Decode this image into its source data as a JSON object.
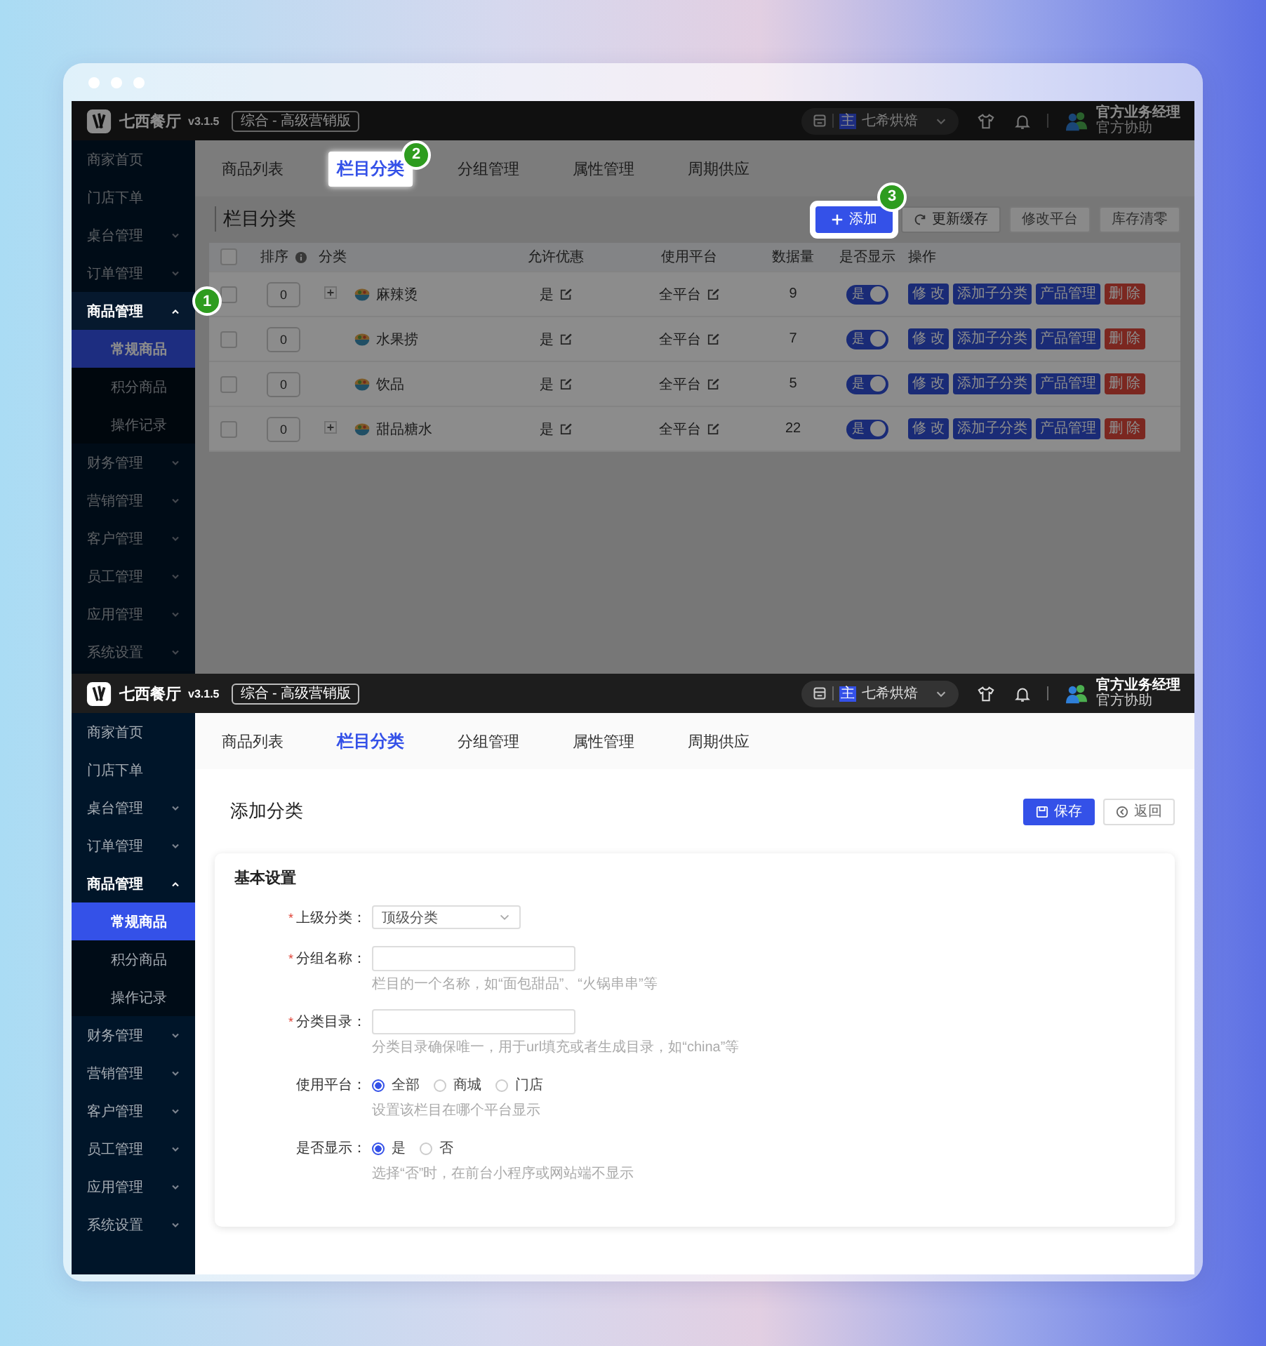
{
  "screens": [
    {
      "kind": "table",
      "dimmed": true,
      "header": {
        "brand": "七西餐厅",
        "version": "v3.1.5",
        "edition": "综合 - 高级营销版",
        "store_badge": "主",
        "store": "七希烘焙",
        "user_name": "官方业务经理",
        "user_role": "官方协助"
      },
      "sidebar": [
        {
          "label": "商家首页",
          "selected": false
        },
        {
          "label": "门店下单",
          "selected": false
        },
        {
          "label": "桌台管理",
          "selected": false,
          "expanded": false
        },
        {
          "label": "订单管理",
          "selected": false,
          "expanded": false
        },
        {
          "label": "商品管理",
          "selected": false,
          "expanded": true,
          "highlighted": true,
          "callout": "1",
          "children": [
            {
              "label": "常规商品",
              "selected": true
            },
            {
              "label": "积分商品",
              "selected": false
            },
            {
              "label": "操作记录",
              "selected": false
            }
          ]
        },
        {
          "label": "财务管理",
          "selected": false,
          "expanded": false
        },
        {
          "label": "营销管理",
          "selected": false,
          "expanded": false
        },
        {
          "label": "客户管理",
          "selected": false,
          "expanded": false
        },
        {
          "label": "员工管理",
          "selected": false,
          "expanded": false
        },
        {
          "label": "应用管理",
          "selected": false,
          "expanded": false
        },
        {
          "label": "系统设置",
          "selected": false,
          "expanded": false
        }
      ],
      "tabs": [
        {
          "label": "商品列表",
          "selected": false
        },
        {
          "label": "栏目分类",
          "selected": true,
          "highlighted": true,
          "callout": "2"
        },
        {
          "label": "分组管理",
          "selected": false
        },
        {
          "label": "属性管理",
          "selected": false
        },
        {
          "label": "周期供应",
          "selected": false
        }
      ],
      "title": "栏目分类",
      "toolbar": [
        {
          "label": "添加",
          "kind": "add",
          "disabled": false,
          "highlighted": true,
          "callout": "3"
        },
        {
          "label": "更新缓存",
          "kind": "refresh",
          "disabled": false
        },
        {
          "label": "修改平台",
          "kind": "plain",
          "disabled": true
        },
        {
          "label": "库存清零",
          "kind": "plain",
          "disabled": true
        }
      ],
      "table": {
        "select_all_checked": false,
        "columns": [
          {
            "label": "排序",
            "info": true
          },
          {
            "label": "分类"
          },
          {
            "label": "允许优惠"
          },
          {
            "label": "使用平台"
          },
          {
            "label": "数据量"
          },
          {
            "label": "是否显示"
          },
          {
            "label": "操作"
          }
        ],
        "rows": [
          {
            "checked": false,
            "sort": "0",
            "has_children": true,
            "name": "麻辣烫",
            "discount": "是",
            "platform": "全平台",
            "count": "9",
            "show": {
              "on": true,
              "label": "是"
            },
            "actions": [
              {
                "label": "修 改",
                "kind": "primary"
              },
              {
                "label": "添加子分类",
                "kind": "primary"
              },
              {
                "label": "产品管理",
                "kind": "primary"
              },
              {
                "label": "删 除",
                "kind": "danger"
              }
            ]
          },
          {
            "checked": false,
            "sort": "0",
            "has_children": false,
            "name": "水果捞",
            "discount": "是",
            "platform": "全平台",
            "count": "7",
            "show": {
              "on": true,
              "label": "是"
            },
            "actions": [
              {
                "label": "修 改",
                "kind": "primary"
              },
              {
                "label": "添加子分类",
                "kind": "primary"
              },
              {
                "label": "产品管理",
                "kind": "primary"
              },
              {
                "label": "删 除",
                "kind": "danger"
              }
            ]
          },
          {
            "checked": false,
            "sort": "0",
            "has_children": false,
            "name": "饮品",
            "discount": "是",
            "platform": "全平台",
            "count": "5",
            "show": {
              "on": true,
              "label": "是"
            },
            "actions": [
              {
                "label": "修 改",
                "kind": "primary"
              },
              {
                "label": "添加子分类",
                "kind": "primary"
              },
              {
                "label": "产品管理",
                "kind": "primary"
              },
              {
                "label": "删 除",
                "kind": "danger"
              }
            ]
          },
          {
            "checked": false,
            "sort": "0",
            "has_children": true,
            "name": "甜品糖水",
            "discount": "是",
            "platform": "全平台",
            "count": "22",
            "show": {
              "on": true,
              "label": "是"
            },
            "actions": [
              {
                "label": "修 改",
                "kind": "primary"
              },
              {
                "label": "添加子分类",
                "kind": "primary"
              },
              {
                "label": "产品管理",
                "kind": "primary"
              },
              {
                "label": "删 除",
                "kind": "danger"
              }
            ]
          }
        ]
      }
    },
    {
      "kind": "form",
      "dimmed": false,
      "header": {
        "brand": "七西餐厅",
        "version": "v3.1.5",
        "edition": "综合 - 高级营销版",
        "store_badge": "主",
        "store": "七希烘焙",
        "user_name": "官方业务经理",
        "user_role": "官方协助"
      },
      "sidebar": [
        {
          "label": "商家首页",
          "selected": false
        },
        {
          "label": "门店下单",
          "selected": false
        },
        {
          "label": "桌台管理",
          "selected": false,
          "expanded": false
        },
        {
          "label": "订单管理",
          "selected": false,
          "expanded": false
        },
        {
          "label": "商品管理",
          "selected": false,
          "expanded": true,
          "children": [
            {
              "label": "常规商品",
              "selected": true
            },
            {
              "label": "积分商品",
              "selected": false
            },
            {
              "label": "操作记录",
              "selected": false
            }
          ]
        },
        {
          "label": "财务管理",
          "selected": false,
          "expanded": false
        },
        {
          "label": "营销管理",
          "selected": false,
          "expanded": false
        },
        {
          "label": "客户管理",
          "selected": false,
          "expanded": false
        },
        {
          "label": "员工管理",
          "selected": false,
          "expanded": false
        },
        {
          "label": "应用管理",
          "selected": false,
          "expanded": false
        },
        {
          "label": "系统设置",
          "selected": false,
          "expanded": false
        }
      ],
      "tabs": [
        {
          "label": "商品列表",
          "selected": false
        },
        {
          "label": "栏目分类",
          "selected": true
        },
        {
          "label": "分组管理",
          "selected": false
        },
        {
          "label": "属性管理",
          "selected": false
        },
        {
          "label": "周期供应",
          "selected": false
        }
      ],
      "title": "添加分类",
      "actions": [
        {
          "label": "保存",
          "kind": "save"
        },
        {
          "label": "返回",
          "kind": "back"
        }
      ],
      "card_title": "基本设置",
      "fields": [
        {
          "kind": "select",
          "mark": "*",
          "label": "上级分类：",
          "value": "顶级分类"
        },
        {
          "kind": "input",
          "mark": "*",
          "label": "分组名称：",
          "hint": "栏目的一个名称，如“面包甜品”、“火锅串串”等"
        },
        {
          "kind": "input",
          "mark": "*",
          "label": "分类目录：",
          "hint": "分类目录确保唯一，用于url填充或者生成目录，如“china”等"
        },
        {
          "kind": "radio",
          "label": "使用平台：",
          "options": [
            {
              "label": "全部",
              "selected": true
            },
            {
              "label": "商城",
              "selected": false
            },
            {
              "label": "门店",
              "selected": false
            }
          ],
          "hint": "设置该栏目在哪个平台显示"
        },
        {
          "kind": "radio",
          "label": "是否显示：",
          "options": [
            {
              "label": "是",
              "selected": true
            },
            {
              "label": "否",
              "selected": false
            }
          ],
          "hint": "选择“否”时，在前台小程序或网站端不显示"
        }
      ]
    }
  ]
}
